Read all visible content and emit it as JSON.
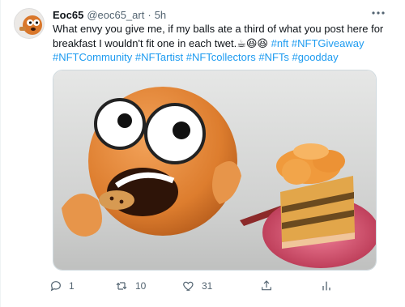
{
  "tweet": {
    "author_name": "Eoc65",
    "handle": "@eoc65_art",
    "dot": "·",
    "time": "5h",
    "text": "What envy you give me, if my balls ate a third of what you post here for breakfast I wouldn't fit one in each twet.☕😆😆",
    "hashtags_line1": [
      "#nft",
      "#NFTGiveaway"
    ],
    "hashtags_line2": [
      "#NFTCommunity",
      "#NFTartist",
      "#NFTcollectors",
      "#NFTs",
      "#goodday"
    ]
  },
  "actions": {
    "reply_count": "1",
    "retweet_count": "10",
    "like_count": "31"
  },
  "icons": {
    "more": "more-icon",
    "reply": "reply-icon",
    "retweet": "retweet-icon",
    "like": "like-icon",
    "share": "share-icon",
    "analytics": "analytics-icon"
  },
  "colors": {
    "link": "#1d9bf0",
    "muted": "#536471",
    "text": "#0f1419"
  }
}
